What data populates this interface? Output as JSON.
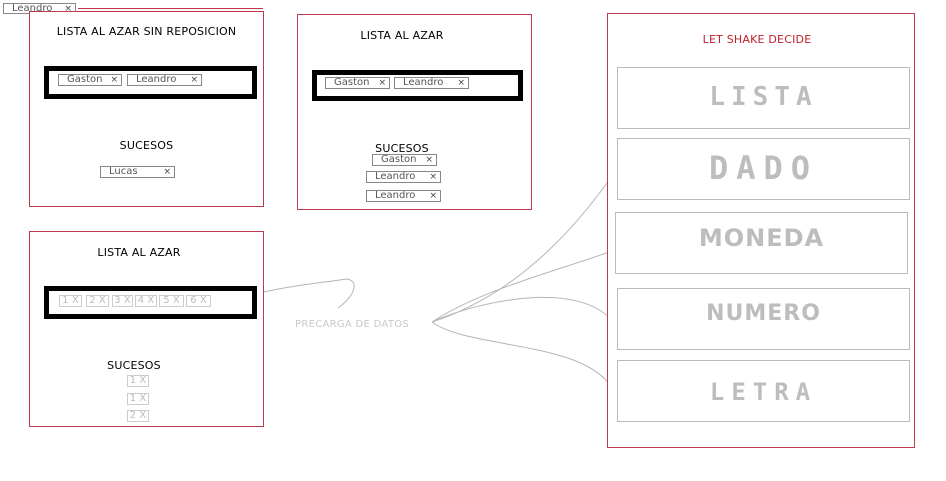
{
  "top_tag": {
    "label": "Leandro",
    "close": "×"
  },
  "panel_sin_repo": {
    "title": "LISTA AL AZAR SIN REPOSICION",
    "list": [
      {
        "label": "Gaston",
        "close": "×"
      },
      {
        "label": "Leandro",
        "close": "×"
      }
    ],
    "sucesos_title": "SUCESOS",
    "sucesos": [
      {
        "label": "Lucas",
        "close": "×"
      }
    ]
  },
  "panel_azar_top": {
    "title": "LISTA AL AZAR",
    "list": [
      {
        "label": "Gaston",
        "close": "×"
      },
      {
        "label": "Leandro",
        "close": "×"
      }
    ],
    "sucesos_title": "SUCESOS",
    "sucesos": [
      {
        "label": "Gaston",
        "close": "×"
      },
      {
        "label": "Leandro",
        "close": "×"
      },
      {
        "label": "Leandro",
        "close": "×"
      }
    ]
  },
  "panel_azar_bottom": {
    "title": "LISTA AL AZAR",
    "list": [
      "1 X",
      "2 X",
      "3 X",
      "4 X",
      "5 X",
      "6 X"
    ],
    "sucesos_title": "SUCESOS",
    "sucesos": [
      "1 X",
      "1 X",
      "2 X"
    ]
  },
  "precarga_label": "PRECARGA DE DATOS",
  "shake_panel": {
    "title": "LET SHAKE DECIDE",
    "options": [
      "LISTA",
      "DADO",
      "MONEDA",
      "NUMERO",
      "LETRA"
    ]
  },
  "colors": {
    "panel_border": "#c0394a",
    "shake_title": "#c0202a",
    "option_text": "#bdbdbd"
  }
}
